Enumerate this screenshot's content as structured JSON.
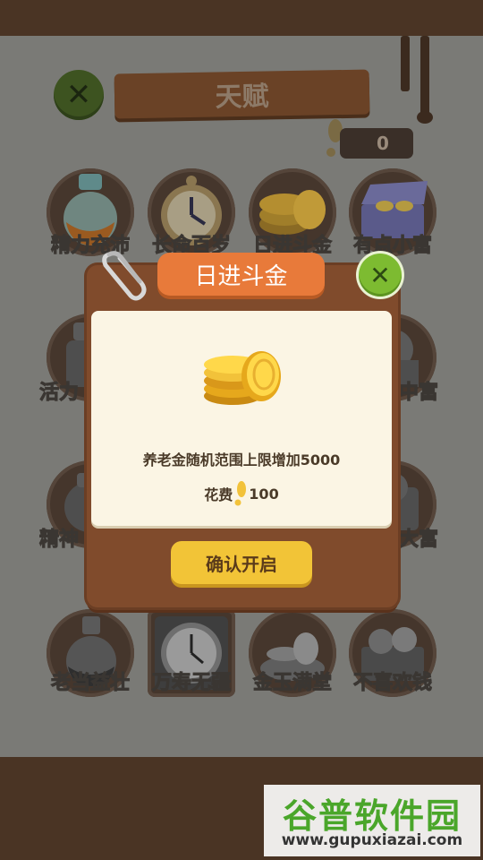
{
  "header": {
    "title": "天赋"
  },
  "coins": {
    "count": "0"
  },
  "talents": [
    {
      "label": "精力充沛"
    },
    {
      "label": "长命百岁"
    },
    {
      "label": "日进斗金"
    },
    {
      "label": "有点小富"
    },
    {
      "label": "活力"
    },
    {
      "label": "中富"
    },
    {
      "label": "精神"
    },
    {
      "label": "大富"
    },
    {
      "label": "老当益壮"
    },
    {
      "label": "万寿无疆"
    },
    {
      "label": "金玉满堂"
    },
    {
      "label": "不喜欢钱"
    }
  ],
  "modal": {
    "title": "日进斗金",
    "description": "养老金随机范围上限增加5000",
    "cost_label": "花费",
    "cost_value": "100",
    "confirm_label": "确认开启"
  },
  "watermark": {
    "title": "谷普软件园",
    "url": "www.gupuxiazai.com"
  },
  "colors": {
    "modal_bg": "#804b2c",
    "title_orange": "#e87a3a",
    "confirm_yellow": "#f2c437",
    "close_green": "#7dbb31"
  }
}
